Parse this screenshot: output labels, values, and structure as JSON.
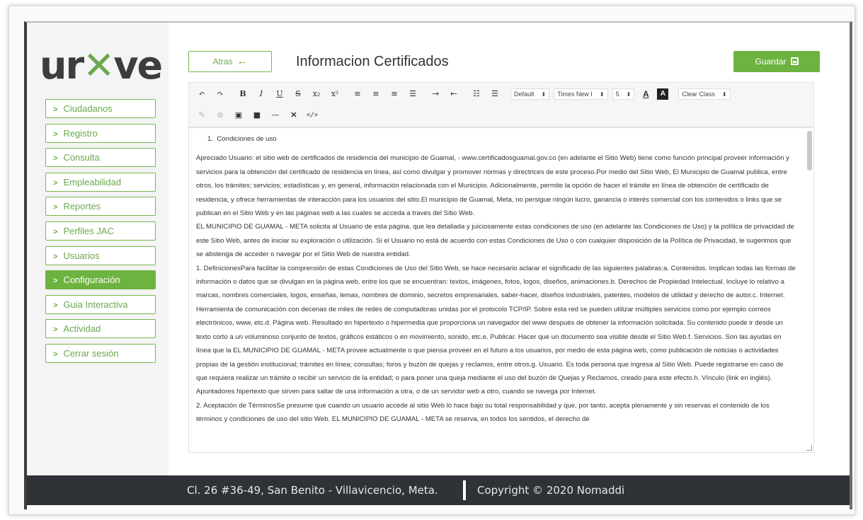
{
  "app": {
    "logo_text_1": "ur",
    "logo_text_2": "ve",
    "logo_mark": "✕"
  },
  "sidebar": {
    "items": [
      {
        "label": "Ciudadanos",
        "active": false
      },
      {
        "label": "Registro",
        "active": false
      },
      {
        "label": "Consulta",
        "active": false
      },
      {
        "label": "Empleabilidad",
        "active": false
      },
      {
        "label": "Reportes",
        "active": false
      },
      {
        "label": "Perfiles JAC",
        "active": false
      },
      {
        "label": "Usuarios",
        "active": false
      },
      {
        "label": "Configuración",
        "active": true
      },
      {
        "label": "Guia Interactiva",
        "active": false
      },
      {
        "label": "Actividad",
        "active": false
      },
      {
        "label": "Cerrar sesión",
        "active": false
      }
    ]
  },
  "header": {
    "back_label": "Atras",
    "title": "Informacion Certificados",
    "save_label": "Guardar"
  },
  "toolbar": {
    "format_select": "Default",
    "font_select": "Times New I",
    "size_select": "5",
    "clear_class_select": "Clear Class"
  },
  "editor": {
    "list_number": "1.",
    "list_item": "Condiciones de uso",
    "paragraphs": [
      "Apreciado Usuario: el sitio web de certificados de residencia del municipio de Guamal, - www.certificadosguamal.gov.co (en adelante el Sitio Web) tiene como función principal proveer información y servicios para la obtención del certificado de residencia en línea, así como divulgar y promover normas y directrices de este proceso.Por medio del Sitio Web, El Municipio de Guamal publica, entre otros, los trámites; servicios; estadísticas y, en general, información relacionada con el Municipio. Adicionalmente, permite la opción de hacer el trámite en línea de obtención de certificado de residencia, y ofrece herramientas de interacción para los usuarios del sitio.El municipio de Guamal, Meta, no persigue ningún lucro, ganancia o interés comercial con los contenidos o links que se publican en el Sitio Web y en las páginas web a las cuales se acceda a través del Sitio Web.",
      "EL MUNICIPIO DE GUAMAL - META solicita al Usuario de esta página, que lea detallada y juiciosamente estas condiciones de uso (en adelante las Condiciones de Uso) y la política de privacidad de este Sitio Web, antes de iniciar su exploración o utilización. Si el Usuario no está de acuerdo con estas Condiciones de Uso o con cualquier disposición de la Política de Privacidad, le sugerimos que se abstenga de acceder o navegar por el Sitio Web de nuestra entidad.",
      "1. DefinicionesPara facilitar la comprensión de estas Condiciones de Uso del Sitio Web, se hace necesario aclarar el significado de las siguientes palabras:a. Contenidos. Implican todas las formas de información o datos que se divulgan en la página web, entre los que se encuentran: textos, imágenes, fotos, logos, diseños, animaciones.b. Derechos de Propiedad Intelectual. Incluye lo relativo a marcas, nombres comerciales, logos, enseñas, lemas, nombres de dominio, secretos empresariales, saber-hacer, diseños industriales, patentes, modelos de utilidad y derecho de autor.c. Internet. Herramienta de comunicación con decenas de miles de redes de computadoras unidas por el protocolo TCP/IP. Sobre esta red se pueden utilizar múltiples servicios como por ejemplo correos electrónicos, www, etc.d. Página web. Resultado en hipertexto o hipermedia que proporciona un navegador del www después de obtener la información solicitada. Su contenido puede ir desde un texto corto a un voluminoso conjunto de textos, gráficos estáticos o en movimiento, sonido, etc.e. Publicar. Hacer que un documento sea visible desde el Sitio Web.f. Servicios. Son las ayudas en línea que la EL MUNICIPIO DE GUAMAL - META provee actualmente o que piensa proveer en el futuro a los usuarios, por medio de esta página web, como publicación de noticias o actividades propias de la gestión institucional; trámites en línea; consultas; foros y buzón de quejas y reclamos, entre otros.g. Usuario. Es toda persona que ingresa al Sitio Web. Puede registrarse en caso de que requiera realizar un trámite o recibir un servicio de la entidad; o para poner una queja mediante el uso del buzón de Quejas y Reclamos, creado para este efecto.h. Vínculo (link en inglés). Apuntadores hipertexto que sirven para saltar de una información a otra, o de un servidor web a otro, cuando se navega por Internet.",
      "2. Aceptación de TérminosSe presume que cuando un usuario accede al sitio Web lo hace bajo su total responsabilidad y que, por tanto, acepta plenamente y sin reservas el contenido de los términos y condiciones de uso del sitio Web. EL MUNICIPIO DE GUAMAL - META se reserva, en todos los sentidos, el derecho de"
    ]
  },
  "footer": {
    "address": "Cl. 26 #36-49, San Benito - Villavicencio, Meta.",
    "copyright": "Copyright © 2020 Nomaddi"
  },
  "colors": {
    "accent": "#6db33f",
    "footer_bg": "#2f3236",
    "logo": "#3d3d3d"
  }
}
